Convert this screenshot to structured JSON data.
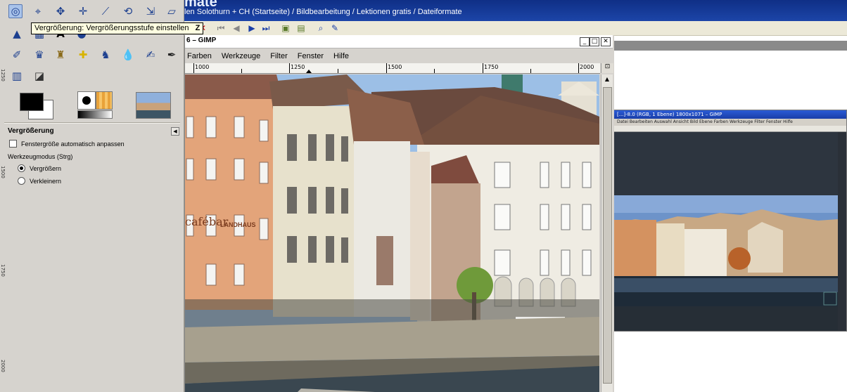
{
  "background_page": {
    "header_title": "mate",
    "breadcrumb": "len Solothurn + CH (Startseite) / Bildbearbeitung / Lektionen gratis / Dateiformate",
    "toolbar_partial_label": "z"
  },
  "toolbox": {
    "tooltip": "Vergrößerung: Vergrößerungsstufe einstellen",
    "tooltip_key": "Z",
    "tool_options": {
      "title": "Vergrößerung",
      "auto_resize_label": "Fenstergröße automatisch anpassen",
      "auto_resize_checked": false,
      "mode_label": "Werkzeugmodus (Strg)",
      "mode_options": [
        "Vergrößern",
        "Verkleinern"
      ],
      "mode_selected": "Vergrößern"
    },
    "left_ruler_labels": [
      "1250",
      "1500",
      "1750",
      "2000"
    ]
  },
  "main_window": {
    "title": "6 – GIMP",
    "menu": [
      "Farben",
      "Werkzeuge",
      "Filter",
      "Fenster",
      "Hilfe"
    ],
    "ruler_labels": [
      "1000",
      "1250",
      "1500",
      "1750",
      "2000"
    ],
    "canvas_texts": {
      "shop_sign": "cafébar",
      "shop_sign2": "LANDHAUS"
    }
  },
  "mini_window": {
    "title": "[...]-8.0 (RGB, 1 Ebene) 1800x1071 – GIMP",
    "menu": "Datei  Bearbeiten  Auswahl  Ansicht  Bild  Ebene  Farben  Werkzeuge  Filter  Fenster  Hilfe"
  },
  "colors": {
    "titlebar_blue": "#1c45a8",
    "toolbox_bg": "#d6d3ce",
    "tooltip_bg": "#ffffe1"
  }
}
